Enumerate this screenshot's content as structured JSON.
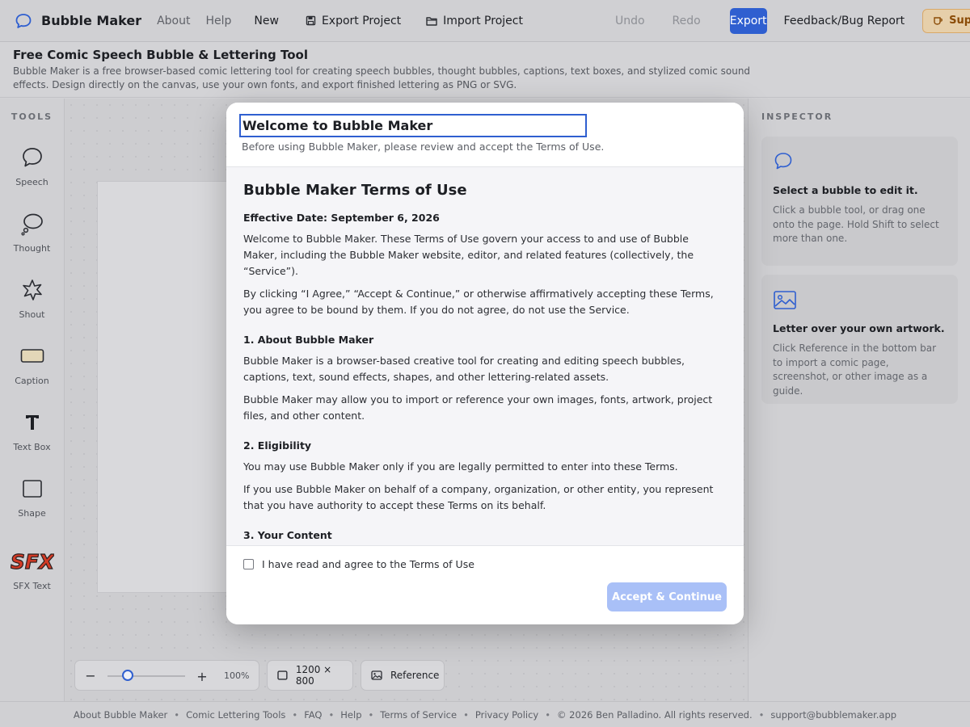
{
  "app": {
    "name": "Bubble Maker"
  },
  "topbar": {
    "nav": [
      "About",
      "Help"
    ],
    "new_label": "New",
    "export_project_label": "Export Project",
    "import_project_label": "Import Project",
    "undo_label": "Undo",
    "redo_label": "Redo",
    "export_label": "Export",
    "feedback_label": "Feedback/Bug Report",
    "support_label": "Support Bubb"
  },
  "intro": {
    "title": "Free Comic Speech Bubble & Lettering Tool",
    "description": "Bubble Maker is a free browser-based comic lettering tool for creating speech bubbles, thought bubbles, captions, text boxes, and stylized comic sound effects. Design directly on the canvas, use your own fonts, and export finished lettering as PNG or SVG."
  },
  "tools": {
    "title": "TOOLS",
    "items": [
      {
        "label": "Speech",
        "icon": "speech-bubble-icon"
      },
      {
        "label": "Thought",
        "icon": "thought-bubble-icon"
      },
      {
        "label": "Shout",
        "icon": "shout-burst-icon"
      },
      {
        "label": "Caption",
        "icon": "caption-box-icon"
      },
      {
        "label": "Text Box",
        "icon": "text-t-icon"
      },
      {
        "label": "Shape",
        "icon": "square-shape-icon"
      },
      {
        "label": "SFX Text",
        "icon": "sfx-logo-icon",
        "icon_text": "SFX"
      }
    ]
  },
  "bottom_bar": {
    "zoom_minus": "−",
    "zoom_plus": "+",
    "zoom_level": "100%",
    "zoom_fraction": 0.25,
    "page_size": "1200 × 800",
    "reference_label": "Reference"
  },
  "inspector": {
    "title": "INSPECTOR",
    "cards": [
      {
        "heading": "Select a bubble to edit it.",
        "text": "Click a bubble tool, or drag one onto the page. Hold Shift to select more than one.",
        "icon": "speech-bubble-icon"
      },
      {
        "heading": "Letter over your own artwork.",
        "text": "Click Reference in the bottom bar to import a comic page, screenshot, or other image as a guide.",
        "icon": "image-icon"
      }
    ]
  },
  "modal": {
    "title": "Welcome to Bubble Maker",
    "subtitle": "Before using Bubble Maker, please review and accept the Terms of Use.",
    "terms_title": "Bubble Maker Terms of Use",
    "effective_date": "Effective Date: September 6, 2026",
    "intro_p1": "Welcome to Bubble Maker. These Terms of Use govern your access to and use of Bubble Maker, including the Bubble Maker website, editor, and related features (collectively, the “Service”).",
    "intro_p2": "By clicking “I Agree,” “Accept & Continue,” or otherwise affirmatively accepting these Terms, you agree to be bound by them. If you do not agree, do not use the Service.",
    "s1_heading": "1. About Bubble Maker",
    "s1_p1": "Bubble Maker is a browser-based creative tool for creating and editing speech bubbles, captions, text, sound effects, shapes, and other lettering-related assets.",
    "s1_p2": "Bubble Maker may allow you to import or reference your own images, fonts, artwork, project files, and other content.",
    "s2_heading": "2. Eligibility",
    "s2_p1": "You may use Bubble Maker only if you are legally permitted to enter into these Terms.",
    "s2_p2": "If you use Bubble Maker on behalf of a company, organization, or other entity, you represent that you have authority to accept these Terms on its behalf.",
    "s3_heading": "3. Your Content",
    "agree_label": "I have read and agree to the Terms of Use",
    "agree_checked": false,
    "accept_label": "Accept & Continue"
  },
  "footer": {
    "links": [
      "About Bubble Maker",
      "Comic Lettering Tools",
      "FAQ",
      "Help",
      "Terms of Service",
      "Privacy Policy"
    ],
    "copyright": "© 2026 Ben Palladino. All rights reserved.",
    "email": "support@bubblemaker.app"
  },
  "colors": {
    "accent": "#2f5fd0",
    "accent_disabled": "#a9c0f7",
    "sfx_red": "#d23a25",
    "support_text": "#8a4b06"
  }
}
